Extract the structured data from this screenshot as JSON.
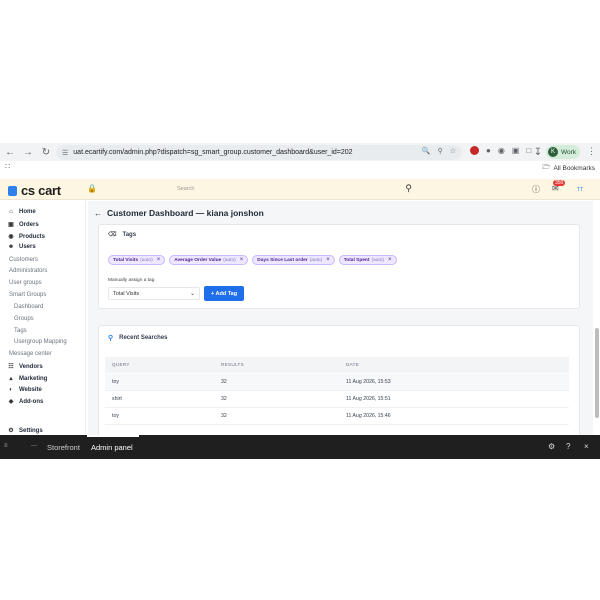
{
  "browser": {
    "url": "uat.ecartify.com/admin.php?dispatch=sg_smart_group.customer_dashboard&user_id=202",
    "profile_initial": "K",
    "profile_label": "Work",
    "all_bookmarks": "All Bookmarks"
  },
  "header": {
    "logo_text": "cs cart",
    "search_placeholder": "Search",
    "notification_count": "350",
    "avatar_initials": "TT"
  },
  "sidebar": {
    "items": [
      {
        "label": "Home",
        "icon": "home-icon"
      },
      {
        "label": "Orders",
        "icon": "cart-icon"
      },
      {
        "label": "Products",
        "icon": "box-icon"
      },
      {
        "label": "Users",
        "icon": "user-icon"
      },
      {
        "label": "Customers"
      },
      {
        "label": "Administrators"
      },
      {
        "label": "User groups"
      },
      {
        "label": "Smart Groups"
      },
      {
        "label": "Dashboard"
      },
      {
        "label": "Groups"
      },
      {
        "label": "Tags"
      },
      {
        "label": "Usergroup Mapping"
      },
      {
        "label": "Message center"
      },
      {
        "label": "Vendors",
        "icon": "vendors-icon"
      },
      {
        "label": "Marketing",
        "icon": "megaphone-icon"
      },
      {
        "label": "Website",
        "icon": "globe-icon"
      },
      {
        "label": "Add-ons",
        "icon": "puzzle-icon"
      },
      {
        "label": "Settings",
        "icon": "gear-icon"
      }
    ]
  },
  "main": {
    "title": "Customer Dashboard — kiana jonshon",
    "tags_section": {
      "title": "Tags",
      "tags": [
        {
          "name": "Total Visits",
          "auto": "(auto)"
        },
        {
          "name": "Average Order Value",
          "auto": "(auto)"
        },
        {
          "name": "Days Since Last order",
          "auto": "(auto)"
        },
        {
          "name": "Total Spent",
          "auto": "(auto)"
        }
      ],
      "assign_label": "Manually assign a tag",
      "selected_tag": "Total Visits",
      "add_button": "+ Add Tag"
    },
    "recent_searches": {
      "title": "Recent Searches",
      "columns": [
        "QUERY",
        "RESULTS",
        "DATE"
      ],
      "rows": [
        {
          "query": "toy",
          "results": "32",
          "date": "11 Aug 2026, 15:53"
        },
        {
          "query": "shirt",
          "results": "32",
          "date": "11 Aug 2026, 15:51"
        },
        {
          "query": "toy",
          "results": "32",
          "date": "11 Aug 2026, 15:46"
        }
      ]
    }
  },
  "bottom_bar": {
    "storefront": "Storefront",
    "admin_panel": "Admin panel"
  }
}
